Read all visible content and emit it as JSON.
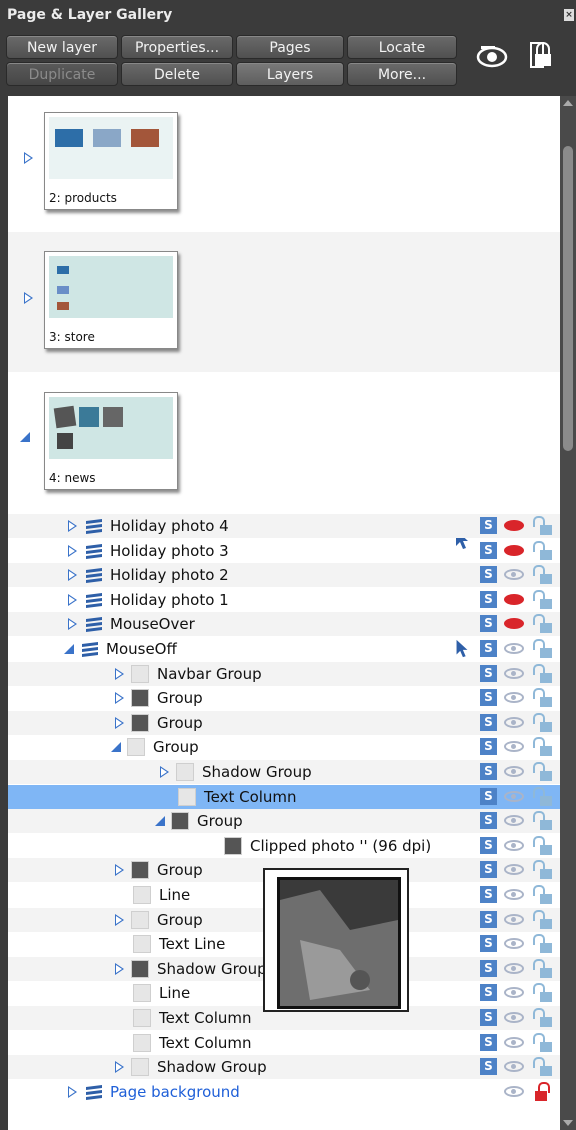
{
  "panel": {
    "title": "Page & Layer Gallery"
  },
  "toolbar": {
    "row1": [
      "New layer",
      "Properties...",
      "Pages",
      "Locate"
    ],
    "row2": [
      "Duplicate",
      "Delete",
      "Layers",
      "More..."
    ]
  },
  "pages": [
    {
      "label": "2: products",
      "expanded": false
    },
    {
      "label": "3: store",
      "expanded": false
    },
    {
      "label": "4: news",
      "expanded": true
    }
  ],
  "tree": [
    {
      "label": "Holiday photo 4",
      "eye": "red"
    },
    {
      "label": "Holiday photo 3",
      "eye": "red"
    },
    {
      "label": "Holiday photo 2",
      "eye": "grey"
    },
    {
      "label": "Holiday photo 1",
      "eye": "red"
    },
    {
      "label": "MouseOver",
      "eye": "red"
    },
    {
      "label": "MouseOff",
      "eye": "grey"
    },
    {
      "label": "Navbar Group"
    },
    {
      "label": "Group"
    },
    {
      "label": "Group"
    },
    {
      "label": "Group"
    },
    {
      "label": "Shadow Group"
    },
    {
      "label": "Text Column"
    },
    {
      "label": "Group"
    },
    {
      "label": "Clipped photo '' (96 dpi)"
    },
    {
      "label": "Group"
    },
    {
      "label": "Line"
    },
    {
      "label": "Group"
    },
    {
      "label": "Text Line"
    },
    {
      "label": "Shadow Group"
    },
    {
      "label": "Line"
    },
    {
      "label": "Text Column"
    },
    {
      "label": "Text Column"
    },
    {
      "label": "Shadow Group"
    },
    {
      "label": "Page background"
    }
  ],
  "s_label": "S",
  "colors": {
    "accent": "#3a73c9",
    "selection": "#7fb6f5",
    "visible_red": "#d9252a"
  }
}
